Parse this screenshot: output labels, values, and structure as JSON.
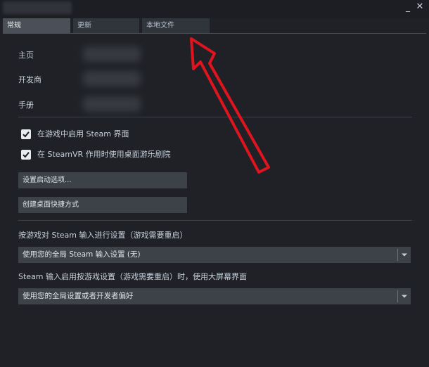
{
  "window": {
    "minimize_icon": "minimize-icon",
    "close_icon": "close-icon",
    "minimize_glyph": "_",
    "close_glyph": "✕"
  },
  "tabs": [
    {
      "label": "常规",
      "active": true
    },
    {
      "label": "更新",
      "active": false
    },
    {
      "label": "本地文件",
      "active": false
    }
  ],
  "info": {
    "home_label": "主页",
    "developer_label": "开发商",
    "manual_label": "手册"
  },
  "options": {
    "overlay_label": "在游戏中启用 Steam 界面",
    "overlay_checked": true,
    "theater_label": "在 SteamVR 作用时使用桌面游乐剧院",
    "theater_checked": true
  },
  "buttons": {
    "launch_options": "设置启动选项...",
    "desktop_shortcut": "创建桌面快捷方式"
  },
  "input_settings": {
    "per_game_label": "按游戏对 Steam 输入进行设置（游戏需要重启）",
    "per_game_value": "使用您的全局 Steam 输入设置 (无)",
    "big_picture_label": "Steam 输入启用按游戏设置（游戏需要重启）时，使用大屏幕界面",
    "big_picture_value": "使用您的全局设置或者开发者偏好"
  },
  "colors": {
    "background": "#1f2126",
    "tab_active": "#4a4f58",
    "tab_inactive": "#30343b",
    "button": "#3d4148",
    "annotation_arrow": "#e0141e"
  }
}
